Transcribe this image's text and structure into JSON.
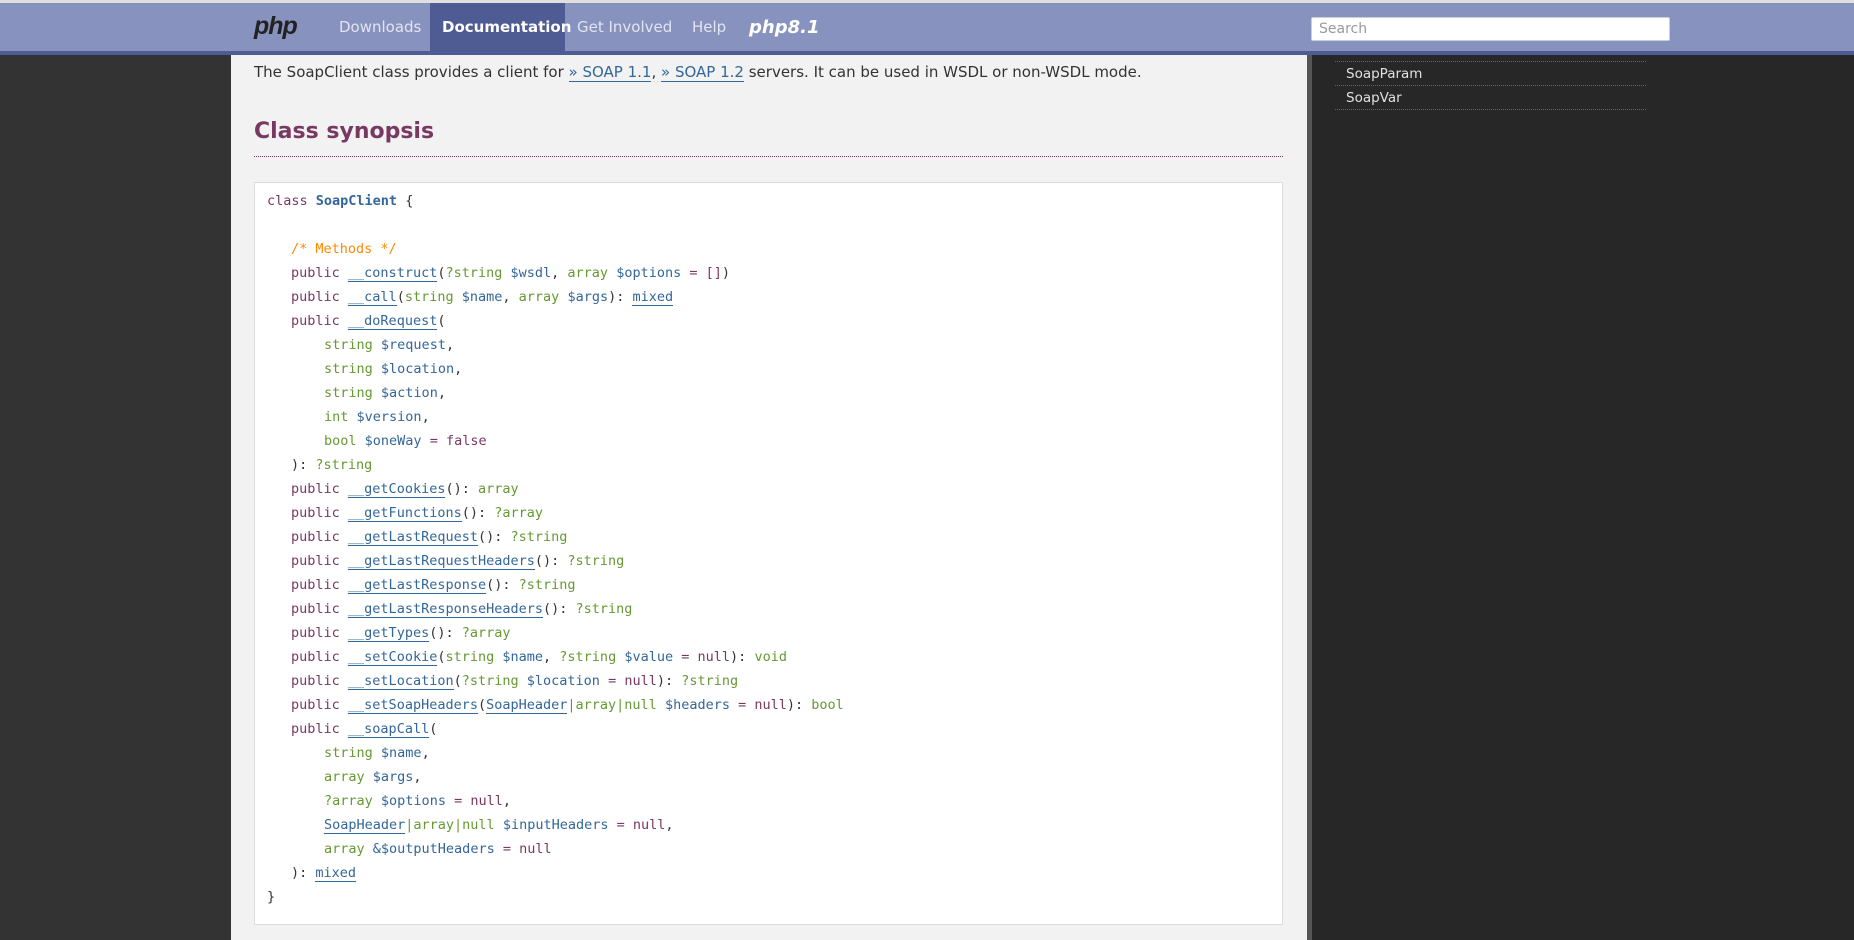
{
  "nav": {
    "logo": "php",
    "items": [
      "Downloads",
      "Documentation",
      "Get Involved",
      "Help"
    ],
    "active": "Documentation",
    "php_version_logo": "php8.1",
    "search_placeholder": "Search"
  },
  "intro": {
    "prefix": "The SoapClient class provides a client for ",
    "link1": "» SOAP 1.1",
    "sep": ", ",
    "link2": "» SOAP 1.2",
    "suffix": " servers. It can be used in WSDL or non-WSDL mode."
  },
  "section_title": "Class synopsis",
  "synopsis": {
    "class_kw": "class",
    "class_name": "SoapClient",
    "open_brace": " {",
    "comment": "/* Methods */",
    "close_brace": "}"
  },
  "sidebar": {
    "items": [
      "SoapParam",
      "SoapVar"
    ]
  },
  "colors": {
    "nav_bg": "#8892bf",
    "nav_active": "#4f5b93",
    "keyword": "#793862",
    "type": "#669933",
    "link": "#336699",
    "comment": "#ff8800"
  }
}
